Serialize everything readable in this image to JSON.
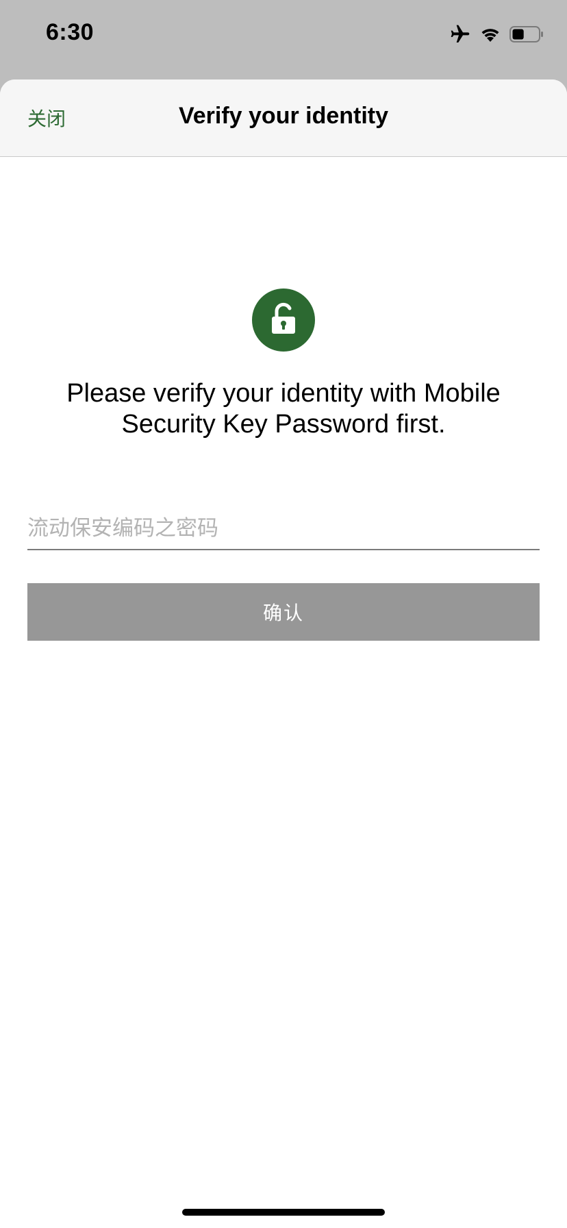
{
  "status_bar": {
    "time": "6:30",
    "icons": [
      "airplane-icon",
      "wifi-icon",
      "battery-icon"
    ],
    "battery_level": 0.45
  },
  "nav": {
    "close_label": "关闭",
    "title": "Verify your identity"
  },
  "lock": {
    "icon": "unlocked-padlock-icon",
    "color": "#2c6931"
  },
  "message": "Please verify your identity with Mobile Security Key Password first.",
  "password_field": {
    "value": "",
    "placeholder": "流动保安编码之密码"
  },
  "confirm_button": {
    "label": "确认",
    "enabled": false
  },
  "colors": {
    "accent": "#2e6b34",
    "button_disabled": "#979797"
  }
}
